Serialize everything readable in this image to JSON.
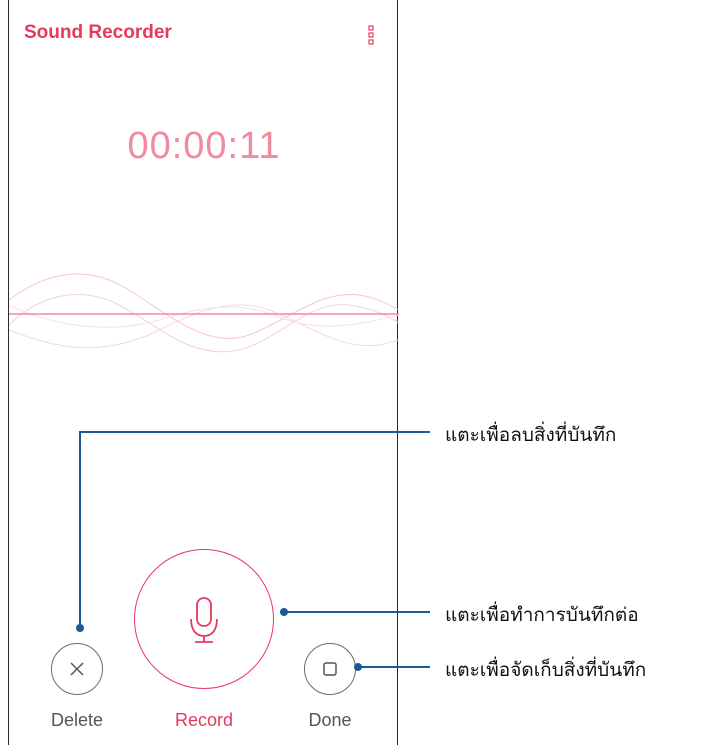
{
  "app": {
    "title": "Sound Recorder",
    "menu_icon": "more-vertical-icon"
  },
  "recorder": {
    "elapsed_time": "00:00:11"
  },
  "controls": {
    "delete_label": "Delete",
    "record_label": "Record",
    "done_label": "Done",
    "delete_icon": "close-icon",
    "record_icon": "microphone-icon",
    "done_icon": "stop-icon"
  },
  "annotations": {
    "delete_hint": "แตะเพื่อลบสิ่งที่บันทึก",
    "record_hint": "แตะเพื่อทำการบันทึกต่อ",
    "done_hint": "แตะเพื่อจัดเก็บสิ่งที่บันทึก"
  },
  "colors": {
    "accent": "#e8385f",
    "timer": "#f08aa0",
    "callout_line": "#1a5a9a"
  }
}
